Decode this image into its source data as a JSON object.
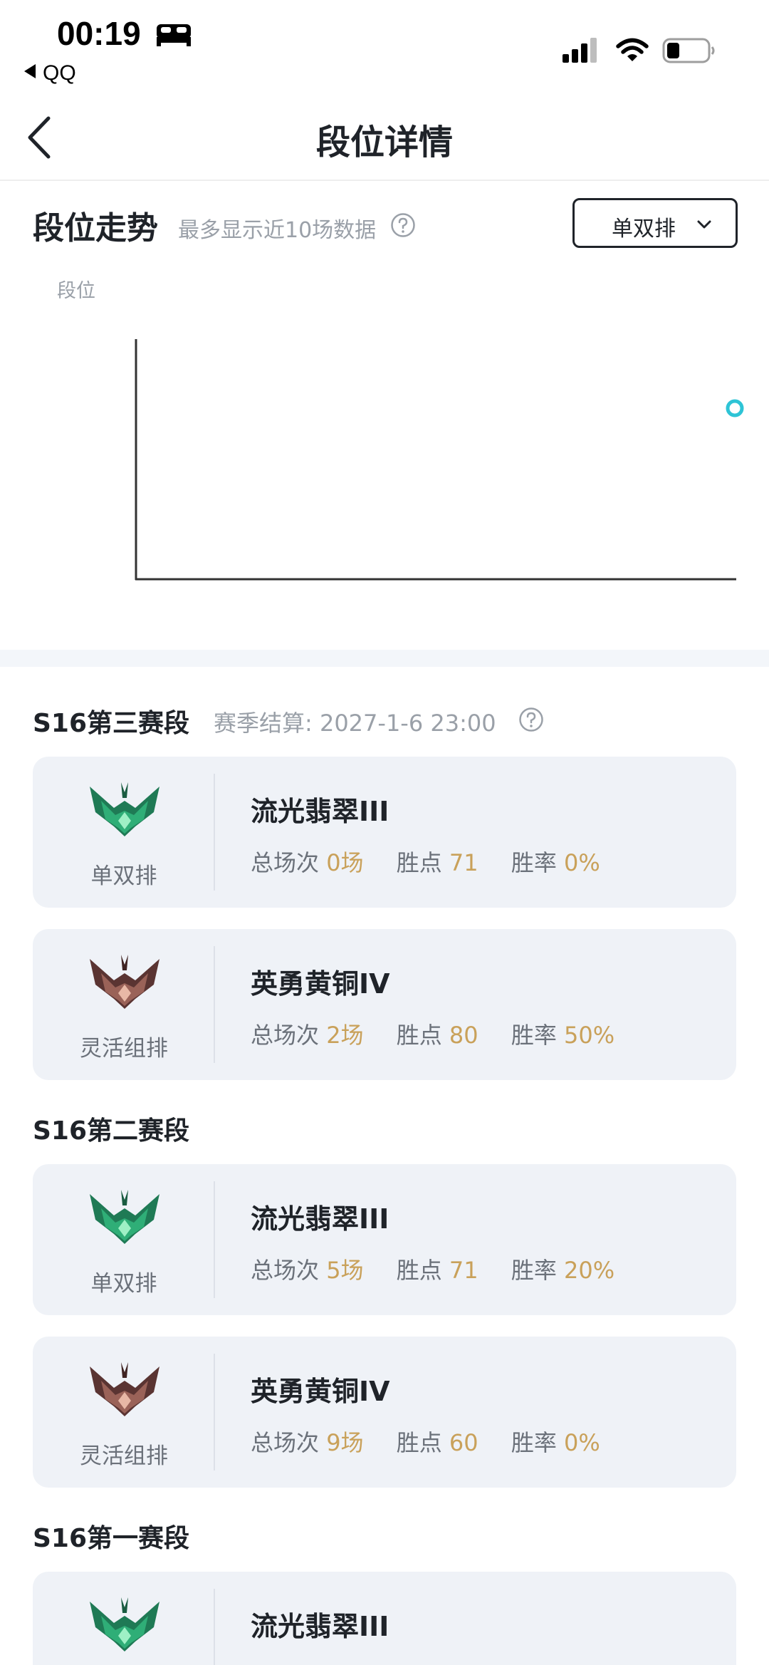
{
  "status_bar": {
    "time": "00:19",
    "back_app": "QQ",
    "icons": [
      "bed-icon",
      "signal-icon",
      "wifi-icon",
      "battery-icon"
    ]
  },
  "nav": {
    "title": "段位详情",
    "back_icon": "chevron-left-icon"
  },
  "trend": {
    "title": "段位走势",
    "subtitle": "最多显示近10场数据",
    "queue_select": "单双排",
    "y_label": "段位"
  },
  "chart_data": {
    "type": "line",
    "x": [],
    "series": [
      {
        "values": []
      }
    ],
    "point_color": "#2ec4d6"
  },
  "seasons": [
    {
      "title": "S16第三赛段",
      "note": "赛季结算: 2027-1-6 23:00",
      "cards": [
        {
          "queue": "单双排",
          "tier": "流光翡翠III",
          "emblem": "emerald-emblem-icon",
          "games_label": "总场次",
          "games": "0场",
          "lp_label": "胜点",
          "lp": "71",
          "wr_label": "胜率",
          "wr": "0%"
        },
        {
          "queue": "灵活组排",
          "tier": "英勇黄铜IV",
          "emblem": "bronze-emblem-icon",
          "games_label": "总场次",
          "games": "2场",
          "lp_label": "胜点",
          "lp": "80",
          "wr_label": "胜率",
          "wr": "50%"
        }
      ]
    },
    {
      "title": "S16第二赛段",
      "note": "",
      "cards": [
        {
          "queue": "单双排",
          "tier": "流光翡翠III",
          "emblem": "emerald-emblem-icon",
          "games_label": "总场次",
          "games": "5场",
          "lp_label": "胜点",
          "lp": "71",
          "wr_label": "胜率",
          "wr": "20%"
        },
        {
          "queue": "灵活组排",
          "tier": "英勇黄铜IV",
          "emblem": "bronze-emblem-icon",
          "games_label": "总场次",
          "games": "9场",
          "lp_label": "胜点",
          "lp": "60",
          "wr_label": "胜率",
          "wr": "0%"
        }
      ]
    },
    {
      "title": "S16第一赛段",
      "note": "",
      "cards": [
        {
          "queue": "",
          "tier": "流光翡翠III",
          "emblem": "emerald-emblem-icon"
        }
      ]
    }
  ],
  "colors": {
    "accent_value": "#c9a15a",
    "card_bg": "#eff2f7",
    "muted_text": "#9aa0a8",
    "chart_point": "#2ec4d6"
  }
}
